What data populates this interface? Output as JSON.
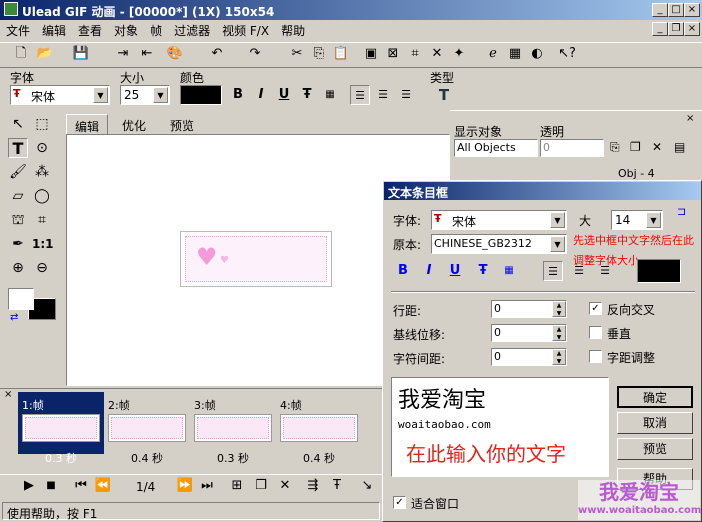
{
  "window": {
    "title": "Ulead GIF 动画 - [00000*] (1X) 150x54"
  },
  "menu": [
    "文件",
    "编辑",
    "查看",
    "对象",
    "帧",
    "过滤器",
    "视频 F/X",
    "帮助"
  ],
  "fontbar": {
    "font_label": "字体",
    "size_label": "大小",
    "color_label": "颜色",
    "type_label": "类型",
    "font_value": "宋体",
    "size_value": "25"
  },
  "tabs": [
    "编辑",
    "优化",
    "预览"
  ],
  "objpanel": {
    "show_label": "显示对象",
    "trans_label": "透明",
    "show_value": "All Objects",
    "trans_value": "0",
    "obj_item": "Obj - 4"
  },
  "frames": [
    {
      "label": "1:帧",
      "time": "0.3 秒"
    },
    {
      "label": "2:帧",
      "time": "0.4 秒"
    },
    {
      "label": "3:帧",
      "time": "0.3 秒"
    },
    {
      "label": "4:帧",
      "time": "0.4 秒"
    }
  ],
  "playback": {
    "counter": "1/4"
  },
  "status": "使用帮助，按 F1",
  "dialog": {
    "title": "文本条目框",
    "font_label": "字体:",
    "font_value": "宋体",
    "size_label": "大",
    "size_value": "14",
    "script_label": "原本:",
    "script_value": "CHINESE_GB2312",
    "hint": "先选中框中文字然后在此调整字体大小",
    "line_label": "行距:",
    "line_value": "0",
    "baseline_label": "基线位移:",
    "baseline_value": "0",
    "spacing_label": "字符间距:",
    "spacing_value": "0",
    "anti_label": "反向交叉",
    "vertical_label": "垂直",
    "kern_label": "字距调整",
    "text_big": "我爱淘宝",
    "text_url": "woaitaobao.com",
    "text_red": "在此输入你的文字",
    "ok": "确定",
    "cancel": "取消",
    "preview": "预览",
    "help": "帮助",
    "fit_label": "适合窗口"
  },
  "watermark": {
    "text": "我爱淘宝",
    "url": "www.woaitaobao.com"
  },
  "colors": {
    "title": "#0a246a",
    "hint": "#ff0000",
    "red_text": "#e0241c"
  }
}
